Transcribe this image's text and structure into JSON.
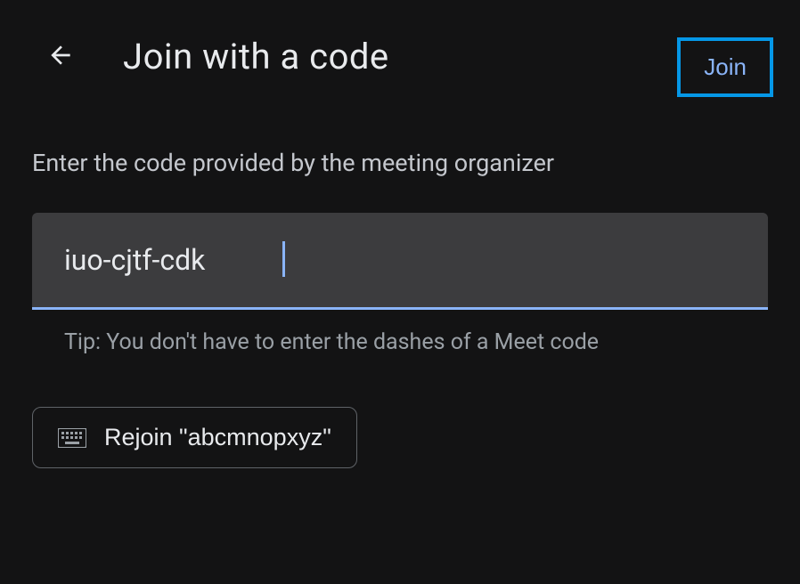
{
  "header": {
    "title": "Join with a code",
    "join_button_label": "Join"
  },
  "main": {
    "instruction": "Enter the code provided by the meeting organizer",
    "code_input_value": "iuo-cjtf-cdk",
    "tip": "Tip: You don't have to enter the dashes of a Meet code",
    "rejoin_label": "Rejoin \"abcmnopxyz\""
  }
}
